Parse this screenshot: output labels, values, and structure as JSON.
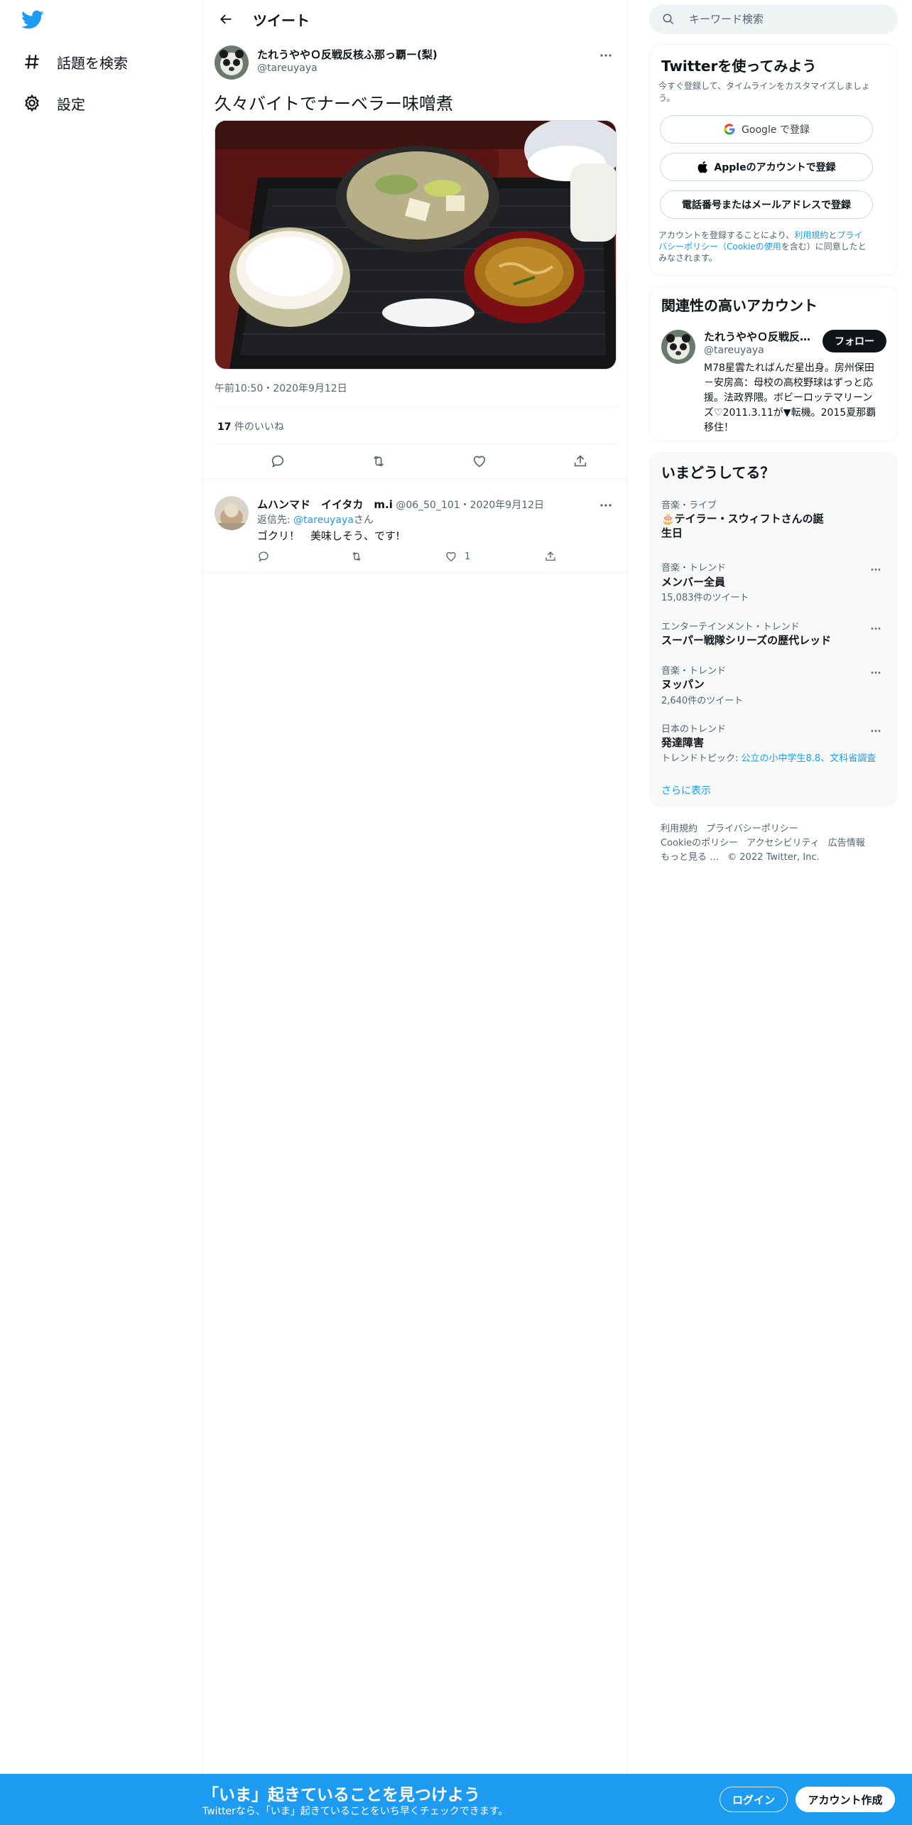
{
  "sidebar": {
    "items": [
      {
        "label": "話題を検索",
        "icon": "hashtag-icon"
      },
      {
        "label": "設定",
        "icon": "gear-icon"
      }
    ]
  },
  "header": {
    "title": "ツイート"
  },
  "tweet": {
    "display_name": "たれうややＯ反戦反核ふ那っ覇ー(梨)",
    "handle": "@tareuyaya",
    "text": "久々バイトでナーベラー味噌煮",
    "timestamp": "午前10:50・2020年9月12日",
    "likes_count": "17",
    "likes_label": " 件のいいね"
  },
  "reply": {
    "display_name": "ムハンマド　イイタカ　m.i",
    "handle_time": " @06_50_101・2020年9月12日",
    "reply_prefix": "返信先: ",
    "reply_mention": "@tareuyaya",
    "reply_suffix": "さん",
    "text": "ゴクリ！　美味しそう、です!",
    "like_count": "1"
  },
  "search": {
    "placeholder": "キーワード検索"
  },
  "signup_card": {
    "title": "Twitterを使ってみよう",
    "subtitle_line1": "今すぐ登録して、タイムラインをカスタマイズしましょ",
    "subtitle_line2": "う。",
    "google_btn": "Google で登録",
    "apple_btn": "Appleのアカウントで登録",
    "phone_btn": "電話番号またはメールアドレスで登録",
    "terms_a": "アカウントを登録することにより、",
    "terms_link1": "利用規約",
    "terms_b": "と",
    "terms_link2": "プライ",
    "terms_link2b": "バシーポリシー（Cookieの使用",
    "terms_c": "を含む）に同意したと",
    "terms_d": "みなされます。"
  },
  "related_card": {
    "title": "関連性の高いアカウント",
    "display_name": "たれうややＯ反戦反…",
    "handle": "@tareuyaya",
    "follow_label": "フォロー",
    "bio_lines": [
      "M78星雲たればんだ星出身。房州保田",
      "－安房高：母校の高校野球はずっと応",
      "援。法政界隈。ボビーロッテマリーン",
      "ズ♡2011.3.11が▼転機。2015夏那覇",
      "移住！"
    ]
  },
  "trends_card": {
    "title": "いまどうしてる？",
    "items": [
      {
        "meta": "音楽・ライブ",
        "name_line1": "🎂テイラー・スウィフトさんの誕",
        "name_line2": "生日",
        "count": ""
      },
      {
        "meta": "音楽・トレンド",
        "name_line1": "メンバー全員",
        "name_line2": "",
        "count": "15,083件のツイート"
      },
      {
        "meta": "エンターテインメント・トレンド",
        "name_line1": "スーパー戦隊シリーズの歴代レッド",
        "name_line2": "",
        "count": ""
      },
      {
        "meta": "音楽・トレンド",
        "name_line1": "ヌッパン",
        "name_line2": "",
        "count": "2,640件のツイート"
      },
      {
        "meta": "日本のトレンド",
        "name_line1": "発達障害",
        "name_line2": "",
        "count": ""
      }
    ],
    "topic_prefix": "トレンドトピック: ",
    "topic_links": "公立の小中学生8.8、文科省調査",
    "show_more": "さらに表示"
  },
  "footer": {
    "row1": [
      "利用規約",
      "プライバシーポリシー"
    ],
    "row2": [
      "Cookieのポリシー",
      "アクセシビリティ",
      "広告情報"
    ],
    "row3": [
      "もっと見る …",
      "© 2022 Twitter, Inc."
    ]
  },
  "bottom_bar": {
    "title": "「いま」起きていることを見つけよう",
    "subtitle": "Twitterなら、「いま」起きていることをいち早くチェックできます。",
    "login_label": "ログイン",
    "signup_label": "アカウント作成"
  },
  "colors": {
    "accent": "#1d9bf0",
    "text": "#0f1419",
    "muted": "#536471"
  }
}
